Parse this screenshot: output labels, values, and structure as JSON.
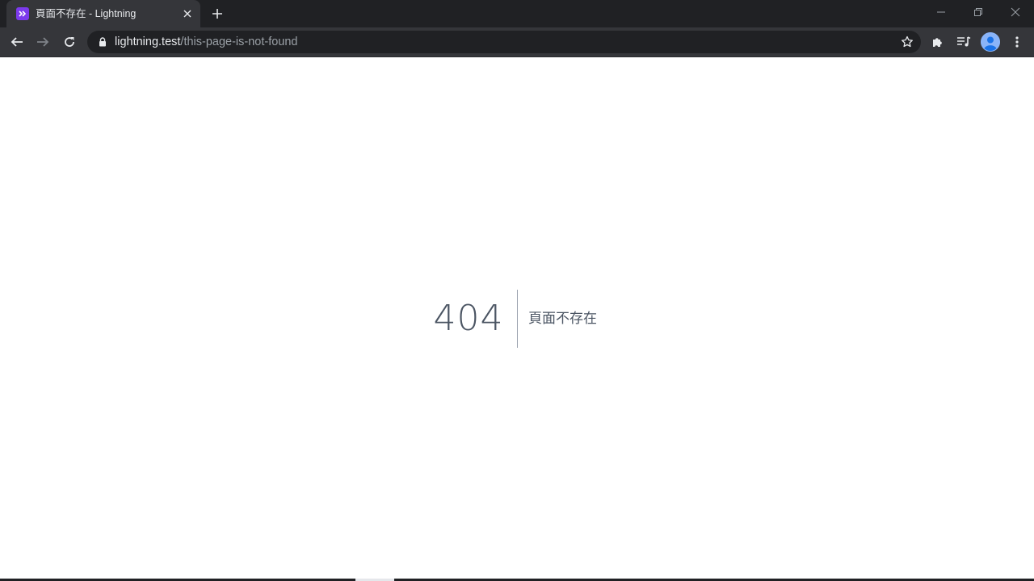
{
  "browser": {
    "tab": {
      "title": "頁面不存在 - Lightning",
      "favicon_icon": "double-chevron-right-icon",
      "favicon_color": "#7c3aed"
    },
    "url": {
      "host": "lightning.test",
      "path": "/this-page-is-not-found"
    },
    "colors": {
      "tabstrip": "#202124",
      "toolbar": "#35363a",
      "omnibox": "#202124"
    }
  },
  "page": {
    "error_code": "404",
    "error_message": "頁面不存在",
    "text_color": "#4b5563"
  }
}
